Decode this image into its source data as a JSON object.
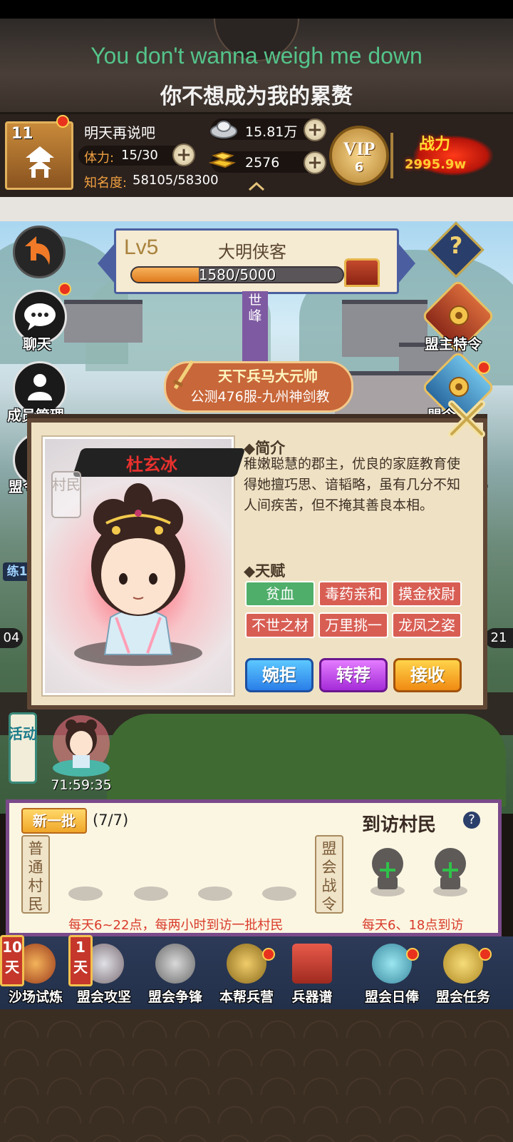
{
  "lyrics": {
    "english": "You don't wanna weigh me down",
    "chinese": "你不想成为我的累赘"
  },
  "player": {
    "level": "11",
    "name": "明天再说吧",
    "stamina_label": "体力:",
    "stamina_value": "15/30",
    "fame_label": "知名度:",
    "fame_value": "58105/58300",
    "silver": "15.81万",
    "gold": "2576",
    "vip_label": "VIP",
    "vip_level": "6",
    "power_label": "战力",
    "power_value": "2995.9w"
  },
  "alliance": {
    "level": "Lv5",
    "title": "大明侠客",
    "xp_text": "1580/5000",
    "xp_fraction": 0.316,
    "pillar_text": "世峰",
    "honor_title": "天下兵马大元帅",
    "honor_sub": "公测476服-九州神剑教",
    "help": "?"
  },
  "side_left": {
    "chat": "聊天",
    "members": "成员管理",
    "alliance": "盟令",
    "train": "练1",
    "left_num": "04"
  },
  "side_right": {
    "leader_order": "盟主特令",
    "item2": "盟令",
    "item3": "令",
    "right_num": "21"
  },
  "dialog": {
    "char_name": "杜玄冰",
    "role_tag": "村民",
    "intro_head": "◆简介",
    "intro_text": "稚嫩聪慧的郡主，优良的家庭教育使得她擅巧思、谙韬略，虽有几分不知人间疾苦，但不掩其善良本相。",
    "talent_head": "◆天赋",
    "talents": [
      "贫血",
      "毒药亲和",
      "摸金校尉",
      "不世之材",
      "万里挑一",
      "龙凤之姿"
    ],
    "btn_reject": "婉拒",
    "btn_refer": "转荐",
    "btn_accept": "接收"
  },
  "activity": {
    "tag": "活动",
    "timer": "71:59:35"
  },
  "villagers": {
    "batch_btn": "新一批",
    "batch_count": "(7/7)",
    "title": "到访村民",
    "help": "?",
    "normal_tag": "普通村民",
    "war_tag": "盟会战令",
    "note_left": "每天6~22点，每两小时到访一批村民",
    "note_right": "每天6、18点到访"
  },
  "bottom_nav": [
    {
      "label": "沙场试炼",
      "day": "10天"
    },
    {
      "label": "盟会攻坚",
      "day": "1天"
    },
    {
      "label": "盟会争锋"
    },
    {
      "label": "本帮兵营"
    },
    {
      "label": "兵器谱"
    },
    {
      "label": "盟会日俸"
    },
    {
      "label": "盟会任务"
    }
  ],
  "colors": {
    "lyric_green": "#54c48a",
    "talent_good": "#4fae6a",
    "talent_bad": "#d85e54",
    "note_red": "#d93a2a"
  }
}
